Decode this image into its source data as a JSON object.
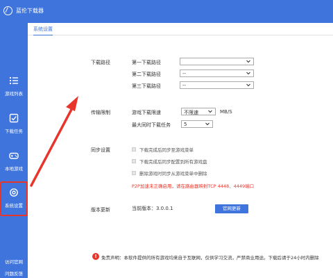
{
  "app": {
    "title": "蓝伦下载器"
  },
  "sidebar": {
    "items": [
      {
        "label": "游戏列表",
        "icon": "list-icon"
      },
      {
        "label": "下载任务",
        "icon": "checkbox-icon"
      },
      {
        "label": "本地游戏",
        "icon": "gamepad-icon"
      },
      {
        "label": "系统设置",
        "icon": "gear-icon",
        "active": true
      }
    ],
    "footer": {
      "website": "访问官网",
      "feedback": "问题反馈"
    }
  },
  "tabs": {
    "active": "系统设置"
  },
  "download_path": {
    "section": "下载路径",
    "rows": [
      {
        "label": "第一下载路径",
        "value": ""
      },
      {
        "label": "第二下载路径",
        "value": "--"
      },
      {
        "label": "第三下载路径",
        "value": "--"
      }
    ]
  },
  "transfer": {
    "section": "传输限制",
    "speed_label": "游戏下载限速",
    "speed_value": "不限速",
    "speed_unit": "MB/S",
    "max_label": "最大同时下载任务",
    "max_value": "5"
  },
  "sync": {
    "section": "同步设置",
    "options": [
      "下载完成后同步至游戏菜单",
      "下载完成后同步配置到所有游戏盘",
      "删除游戏时同步从游戏菜单中删除"
    ],
    "note": "P2P加速未正确启用，请在路由器映射TCP 4448、4449端口"
  },
  "version": {
    "section": "版本更新",
    "current": "当前版本：3.0.0.1",
    "update_button": "官网更新"
  },
  "disclaimer": {
    "icon": "!",
    "text": "免责声明：本软件提供的所有游戏均来自于互联网，仅供学习交流，严禁商业用途。下载后请于24小时内删除"
  },
  "colors": {
    "brand": "#3e74dc",
    "alert": "#e8352b"
  }
}
